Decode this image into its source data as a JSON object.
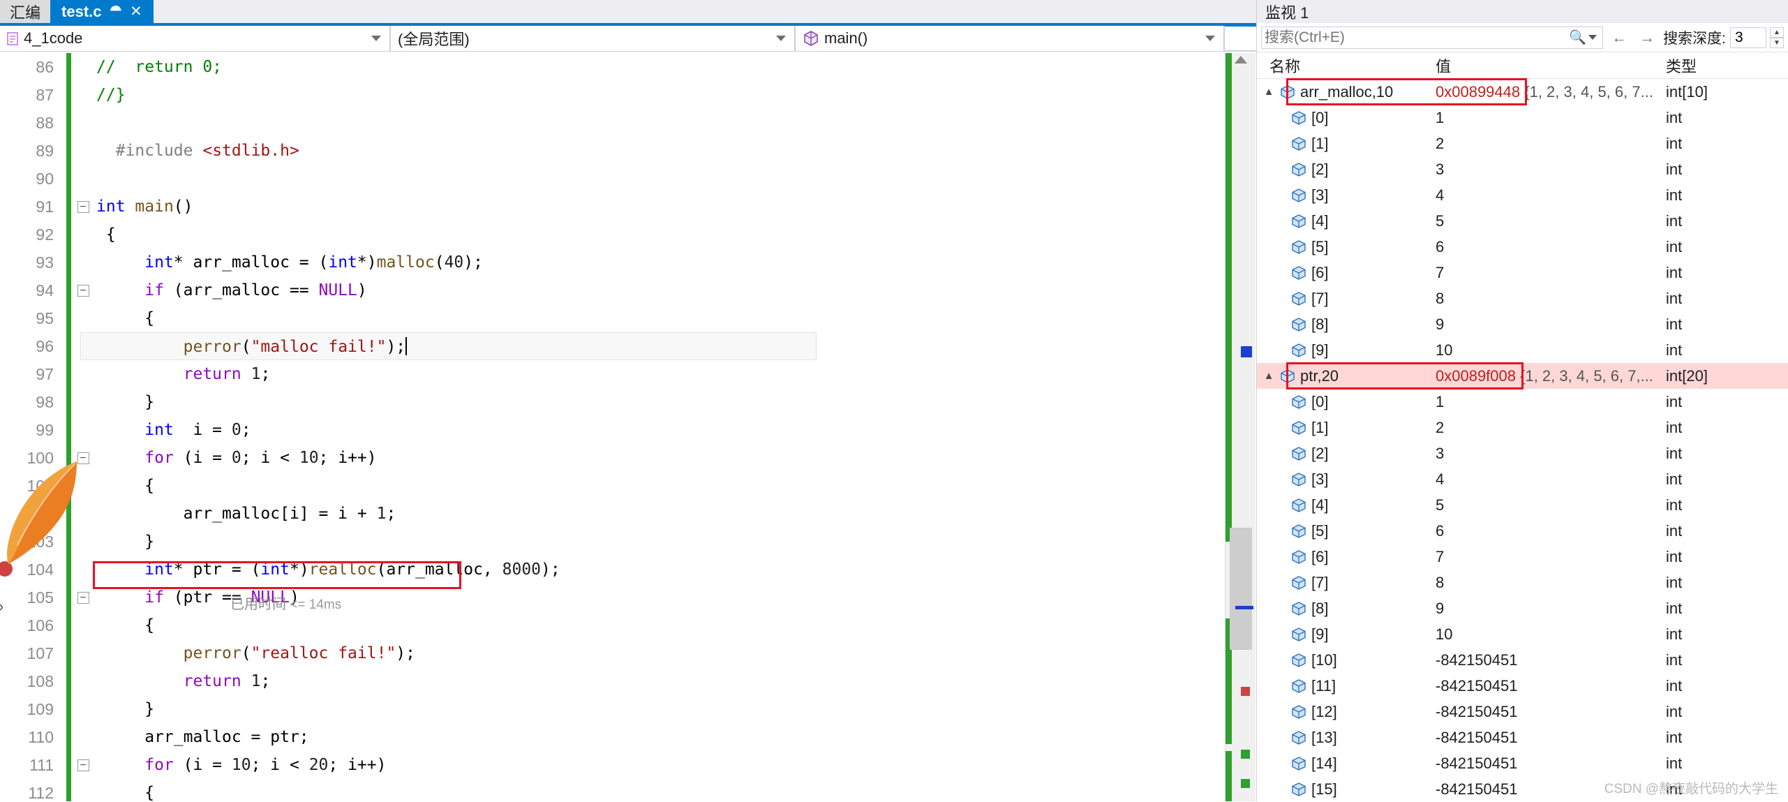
{
  "window": {
    "tabs": [
      {
        "label": "汇编",
        "active": false,
        "truncated": true
      },
      {
        "label": "test.c",
        "active": true,
        "pin_icon": "pin-icon",
        "close_icon": "close-icon"
      }
    ],
    "gear_icon": "gear-icon"
  },
  "navbar": {
    "project": "4_1code",
    "project_icon": "file-icon",
    "scope": "(全局范围)",
    "member": "main()",
    "member_icon": "cube-icon",
    "dropdown_icon": "chevron-down-icon",
    "splitter_icon": "split-editor-icon"
  },
  "editor": {
    "inline_hint": "已用时间",
    "inline_hint_value": "<= 14ms",
    "lines": [
      {
        "n": "86",
        "fold": "",
        "html": "<span class='cm'>//  return 0;</span>"
      },
      {
        "n": "87",
        "fold": "",
        "html": "<span class='cm'>//}</span>"
      },
      {
        "n": "88",
        "fold": "",
        "html": ""
      },
      {
        "n": "89",
        "fold": "",
        "html": "  <span class='pp'>#include</span> <span class='str'>&lt;stdlib.h&gt;</span>"
      },
      {
        "n": "90",
        "fold": "",
        "html": ""
      },
      {
        "n": "91",
        "fold": "-",
        "html": "<span class='k'>int</span> <span class='fn'>main</span>()"
      },
      {
        "n": "92",
        "fold": "",
        "html": " {"
      },
      {
        "n": "93",
        "fold": "",
        "html": "     <span class='k'>int</span>* arr_malloc = (<span class='k'>int</span>*)<span class='fn'>malloc</span>(<span class='num'>40</span>);"
      },
      {
        "n": "94",
        "fold": "-",
        "html": "     <span class='kp'>if</span> (arr_malloc == <span class='kp'>NULL</span>)"
      },
      {
        "n": "95",
        "fold": "",
        "html": "     {"
      },
      {
        "n": "96",
        "fold": "",
        "html": "         <span class='fn'>perror</span>(<span class='str'>\"malloc fail!\"</span>);"
      },
      {
        "n": "97",
        "fold": "",
        "html": "         <span class='kp'>return</span> <span class='num'>1</span>;"
      },
      {
        "n": "98",
        "fold": "",
        "html": "     }"
      },
      {
        "n": "99",
        "fold": "",
        "html": "     <span class='k'>int</span>  i = <span class='num'>0</span>;"
      },
      {
        "n": "100",
        "fold": "-",
        "html": "     <span class='kp'>for</span> (i = <span class='num'>0</span>; i &lt; <span class='num'>10</span>; i++)"
      },
      {
        "n": "101",
        "fold": "",
        "html": "     {"
      },
      {
        "n": "102",
        "fold": "",
        "html": "         arr_malloc[i] = i + <span class='num'>1</span>;"
      },
      {
        "n": "103",
        "fold": "",
        "html": "     }"
      },
      {
        "n": "104",
        "fold": "",
        "html": "     <span class='k'>int</span>* ptr = (<span class='k'>int</span>*)<span class='fn'>realloc</span>(arr_malloc, <span class='num'>8000</span>);"
      },
      {
        "n": "105",
        "fold": "-",
        "html": "     <span class='kp'>if</span> (ptr == <span class='kp'>NULL</span>)"
      },
      {
        "n": "106",
        "fold": "",
        "html": "     {"
      },
      {
        "n": "107",
        "fold": "",
        "html": "         <span class='fn'>perror</span>(<span class='str'>\"realloc fail!\"</span>);"
      },
      {
        "n": "108",
        "fold": "",
        "html": "         <span class='kp'>return</span> <span class='num'>1</span>;"
      },
      {
        "n": "109",
        "fold": "",
        "html": "     }"
      },
      {
        "n": "110",
        "fold": "",
        "html": "     arr_malloc = ptr;"
      },
      {
        "n": "111",
        "fold": "-",
        "html": "     <span class='kp'>for</span> (i = <span class='num'>10</span>; i &lt; <span class='num'>20</span>; i++)"
      },
      {
        "n": "112",
        "fold": "",
        "html": "     {"
      }
    ]
  },
  "watch": {
    "title": "监视 1",
    "search_placeholder": "搜索(Ctrl+E)",
    "search_value": "",
    "search_icon": "search-icon",
    "dropdown_icon": "chevron-down-icon",
    "prev_icon": "arrow-left-icon",
    "next_icon": "arrow-right-icon",
    "depth_label": "搜索深度:",
    "depth_value": "3",
    "columns": [
      "名称",
      "值",
      "类型"
    ],
    "rows": [
      {
        "name": "arr_malloc,10",
        "value": "0x00899448",
        "value_extra": "{1, 2, 3, 4, 5, 6, 7...",
        "type": "int[10]",
        "indent": 0,
        "expander": "▲",
        "boxed": true,
        "selected": false,
        "addr": true
      },
      {
        "name": "[0]",
        "value": "1",
        "type": "int",
        "indent": 1
      },
      {
        "name": "[1]",
        "value": "2",
        "type": "int",
        "indent": 1
      },
      {
        "name": "[2]",
        "value": "3",
        "type": "int",
        "indent": 1
      },
      {
        "name": "[3]",
        "value": "4",
        "type": "int",
        "indent": 1
      },
      {
        "name": "[4]",
        "value": "5",
        "type": "int",
        "indent": 1
      },
      {
        "name": "[5]",
        "value": "6",
        "type": "int",
        "indent": 1
      },
      {
        "name": "[6]",
        "value": "7",
        "type": "int",
        "indent": 1
      },
      {
        "name": "[7]",
        "value": "8",
        "type": "int",
        "indent": 1
      },
      {
        "name": "[8]",
        "value": "9",
        "type": "int",
        "indent": 1
      },
      {
        "name": "[9]",
        "value": "10",
        "type": "int",
        "indent": 1
      },
      {
        "name": "ptr,20",
        "value": "0x0089f008",
        "value_extra": "{1, 2, 3, 4, 5, 6, 7,...",
        "type": "int[20]",
        "indent": 0,
        "expander": "▲",
        "boxed": true,
        "selected": true,
        "addr": true
      },
      {
        "name": "[0]",
        "value": "1",
        "type": "int",
        "indent": 1
      },
      {
        "name": "[1]",
        "value": "2",
        "type": "int",
        "indent": 1
      },
      {
        "name": "[2]",
        "value": "3",
        "type": "int",
        "indent": 1
      },
      {
        "name": "[3]",
        "value": "4",
        "type": "int",
        "indent": 1
      },
      {
        "name": "[4]",
        "value": "5",
        "type": "int",
        "indent": 1
      },
      {
        "name": "[5]",
        "value": "6",
        "type": "int",
        "indent": 1
      },
      {
        "name": "[6]",
        "value": "7",
        "type": "int",
        "indent": 1
      },
      {
        "name": "[7]",
        "value": "8",
        "type": "int",
        "indent": 1
      },
      {
        "name": "[8]",
        "value": "9",
        "type": "int",
        "indent": 1
      },
      {
        "name": "[9]",
        "value": "10",
        "type": "int",
        "indent": 1
      },
      {
        "name": "[10]",
        "value": "-842150451",
        "type": "int",
        "indent": 1
      },
      {
        "name": "[11]",
        "value": "-842150451",
        "type": "int",
        "indent": 1
      },
      {
        "name": "[12]",
        "value": "-842150451",
        "type": "int",
        "indent": 1
      },
      {
        "name": "[13]",
        "value": "-842150451",
        "type": "int",
        "indent": 1
      },
      {
        "name": "[14]",
        "value": "-842150451",
        "type": "int",
        "indent": 1
      },
      {
        "name": "[15]",
        "value": "-842150451",
        "type": "int",
        "indent": 1
      }
    ]
  },
  "watermark": "CSDN @熬夜敲代码的大学生",
  "colors": {
    "accent": "#007acc",
    "highlight_box": "#e81123",
    "selected_row": "#ffd7d7",
    "changebar_green": "#2ea02e",
    "address_red": "#c01f1f"
  }
}
